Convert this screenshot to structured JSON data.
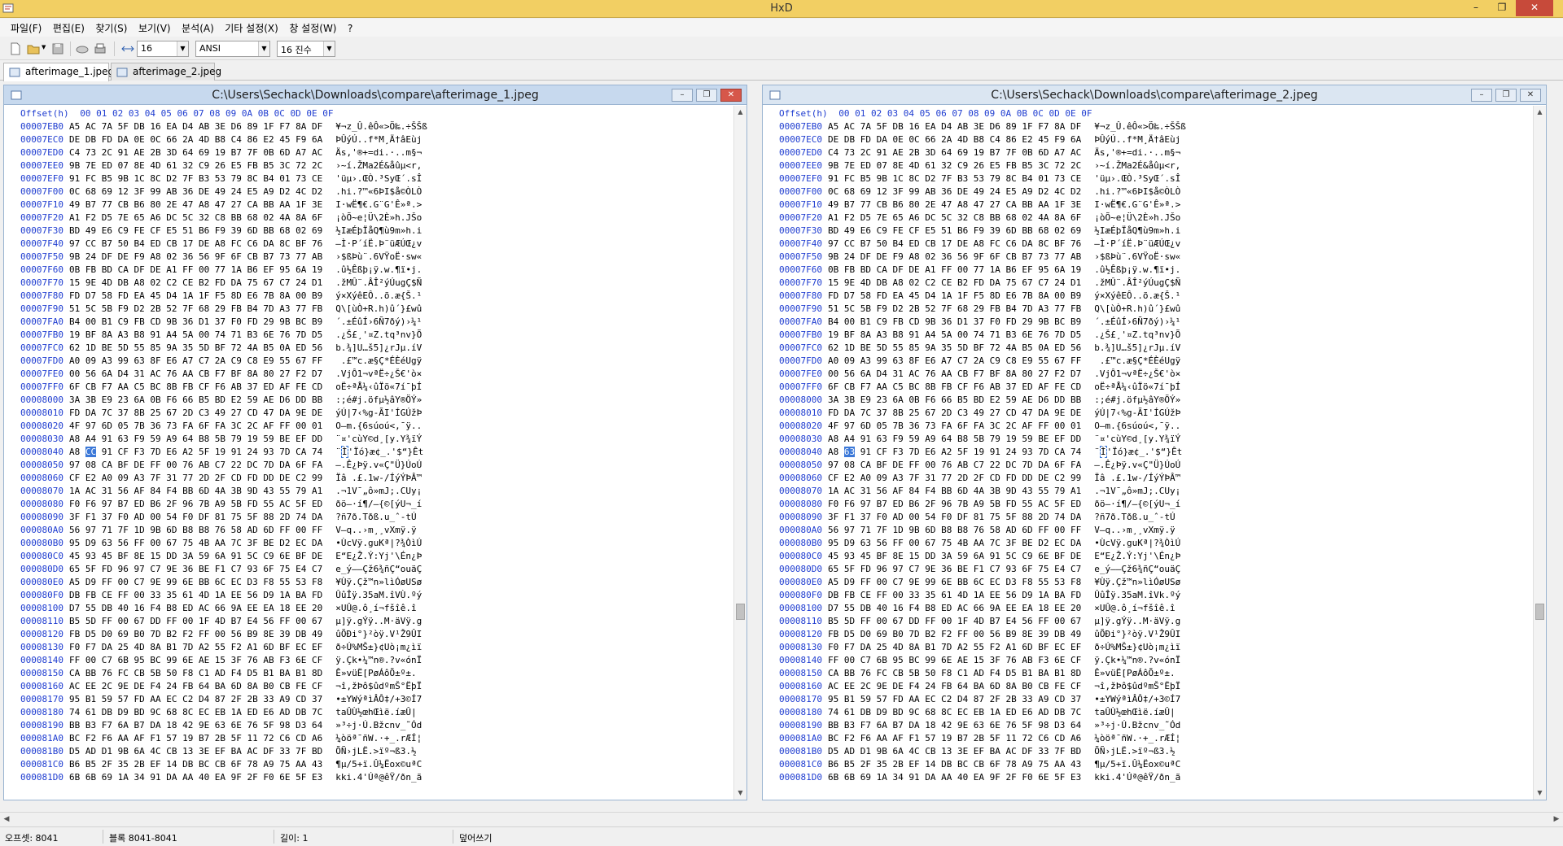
{
  "window": {
    "title": "HxD",
    "minimize_glyph": "–",
    "restore_glyph": "❐",
    "close_glyph": "✕"
  },
  "menu": [
    "파일(F)",
    "편집(E)",
    "찾기(S)",
    "보기(V)",
    "분석(A)",
    "기타 설정(X)",
    "창 설정(W)",
    "?"
  ],
  "toolbar": {
    "bytes_per_row": "16",
    "charset": "ANSI",
    "offset_base": "16 진수"
  },
  "tabs": [
    {
      "label": "afterimage_1.jpeg",
      "active": true
    },
    {
      "label": "afterimage_2.jpeg",
      "active": false
    }
  ],
  "panes": [
    {
      "path": "C:\\Users\\Sechack\\Downloads\\compare\\afterimage_1.jpeg",
      "selected_value": "CC",
      "active": true
    },
    {
      "path": "C:\\Users\\Sechack\\Downloads\\compare\\afterimage_2.jpeg",
      "selected_value": "63",
      "active": false
    }
  ],
  "hex_header": {
    "offset_label": "Offset(h)",
    "columns": "00 01 02 03 04 05 06 07 08 09 0A 0B 0C 0D 0E 0F"
  },
  "rows": [
    {
      "off": "00007EB0",
      "hex": "A5 AC 7A 5F DB 16 EA D4 AB 3E D6 89 1F F7 8A DF",
      "ascii": "¥¬z_Û.êÔ«>Ö‰.÷ŠŠß"
    },
    {
      "off": "00007EC0",
      "hex": "DE DB FD DA 0E 0C 66 2A 4D B8 C4 86 E2 45 F9 6A",
      "ascii": "ÞÛýÚ..f*M¸Ä†âEùj"
    },
    {
      "off": "00007ED0",
      "hex": "C4 73 2C 91 AE 2B 3D 64 69 19 B7 7F 0B 6D A7 AC",
      "ascii": "Äs,'®+=di.·..m§¬"
    },
    {
      "off": "00007EE0",
      "hex": "9B 7E ED 07 8E 4D 61 32 C9 26 E5 FB B5 3C 72 2C",
      "ascii": "›~í.ŽMa2É&åûµ<r,"
    },
    {
      "off": "00007EF0",
      "hex": "91 FC B5 9B 1C 8C D2 7F B3 53 79 8C B4 01 73 CE",
      "ascii": "'üµ›.ŒÒ.³SyŒ´.sÎ"
    },
    {
      "off": "00007F00",
      "hex": "0C 68 69 12 3F 99 AB 36 DE 49 24 E5 A9 D2 4C D2",
      "ascii": ".hi.?™«6ÞI$å©ÒLÒ"
    },
    {
      "off": "00007F10",
      "hex": "49 B7 77 CB B6 80 2E 47 A8 47 27 CA BB AA 1F 3E",
      "ascii": "I·wË¶€.G¨G'Ê»ª.>"
    },
    {
      "off": "00007F20",
      "hex": "A1 F2 D5 7E 65 A6 DC 5C 32 C8 BB 68 02 4A 8A 6F",
      "ascii": "¡òÕ~e¦Ü\\2È»h.JŠo"
    },
    {
      "off": "00007F30",
      "hex": "BD 49 E6 C9 FE CF E5 51 B6 F9 39 6D BB 68 02 69",
      "ascii": "½IæÉþÏåQ¶ù9m»h.i"
    },
    {
      "off": "00007F40",
      "hex": "97 CC B7 50 B4 ED CB 17 DE A8 FC C6 DA 8C BF 76",
      "ascii": "—Ì·P´íË.Þ¨üÆÚŒ¿v"
    },
    {
      "off": "00007F50",
      "hex": "9B 24 DF DE F9 A8 02 36 56 9F 6F CB B7 73 77 AB",
      "ascii": "›$ßÞù¨.6VŸoË·sw«"
    },
    {
      "off": "00007F60",
      "hex": "0B FB BD CA DF DE A1 FF 00 77 1A B6 EF 95 6A 19",
      "ascii": ".û½Êßþ¡ÿ.w.¶ï•j."
    },
    {
      "off": "00007F70",
      "hex": "15 9E 4D DB A8 02 C2 CE B2 FD DA 75 67 C7 24 D1",
      "ascii": ".žMÛ¨.ÂÎ²ýÚugÇ$Ñ"
    },
    {
      "off": "00007F80",
      "hex": "FD D7 58 FD EA 45 D4 1A 1F F5 8D E6 7B 8A 00 B9",
      "ascii": "ý×XýêEÔ..õ.æ{Š.¹"
    },
    {
      "off": "00007F90",
      "hex": "51 5C 5B F9 D2 2B 52 7F 68 29 FB B4 7D A3 77 FB",
      "ascii": "Q\\[ùÒ+R.h)û´}£wû"
    },
    {
      "off": "00007FA0",
      "hex": "B4 00 B1 C9 FB CD 9B 36 D1 37 F0 FD 29 9B BC B9",
      "ascii": "´.±ÉûÍ›6Ñ7ðý)›¼¹"
    },
    {
      "off": "00007FB0",
      "hex": "19 BF 8A A3 B8 91 A4 5A 00 74 71 B3 6E 76 7D D5",
      "ascii": ".¿Š£¸'¤Z.tq³nv}Õ"
    },
    {
      "off": "00007FC0",
      "hex": "62 1D BE 5D 55 85 9A 35 5D BF 72 4A B5 0A ED 56",
      "ascii": "b.¾]U…š5]¿rJµ.íV"
    },
    {
      "off": "00007FD0",
      "hex": "A0 09 A3 99 63 8F E6 A7 C7 2A C9 C8 E9 55 67 FF",
      "ascii": " .£™c.æ§Ç*ÉÈéUgÿ"
    },
    {
      "off": "00007FE0",
      "hex": "00 56 6A D4 31 AC 76 AA CB F7 BF 8A 80 27 F2 D7",
      "ascii": ".VjÔ1¬vªË÷¿Š€'ò×"
    },
    {
      "off": "00007FF0",
      "hex": "6F CB F7 AA C5 BC 8B FB CF F6 AB 37 ED AF FE CD",
      "ascii": "oË÷ªÅ¼‹ûÏö«7í¯þÍ"
    },
    {
      "off": "00008000",
      "hex": "3A 3B E9 23 6A 0B F6 66 B5 BD E2 59 AE D6 DD BB",
      "ascii": ":;é#j.öfµ½âY®ÖÝ»"
    },
    {
      "off": "00008010",
      "hex": "FD DA 7C 37 8B 25 67 2D C3 49 27 CD 47 DA 9E DE",
      "ascii": "ýÚ|7‹%g-ÃI'ÍGÚžÞ"
    },
    {
      "off": "00008020",
      "hex": "4F 97 6D 05 7B 36 73 FA 6F FA 3C 2C AF FF 00 01",
      "ascii": "O—m.{6súoú<,¯ÿ.."
    },
    {
      "off": "00008030",
      "hex": "A8 A4 91 63 F9 59 A9 64 B8 5B 79 19 59 BE EF DD",
      "ascii": "¨¤'cùY©d¸[y.Y¾ïÝ"
    },
    {
      "off": "00008040",
      "hex_pre": "A8 ",
      "hex_mid": "",
      "hex_post": " 91 CF F3 7D E6 A2 5F 19 91 24 93 7D CA 74",
      "ascii_pre": "¨",
      "ascii_mid": "Ì",
      "ascii_post": "'Ïó}æ¢_.'$“}Êt",
      "selected": true
    },
    {
      "off": "00008050",
      "hex": "97 08 CA BF DE FF 00 76 AB C7 22 DC 7D DA 6F FA",
      "ascii": "—.Ê¿Þÿ.v«Ç\"Ü}ÚoÚ"
    },
    {
      "off": "00008060",
      "hex": "CF E2 A0 09 A3 7F 31 77 2D 2F CD FD DD DE C2 99",
      "ascii": "Ïâ .£.1w-/ÍýÝÞÂ™"
    },
    {
      "off": "00008070",
      "hex": "1A AC 31 56 AF 84 F4 BB 6D 4A 3B 9D 43 55 79 A1",
      "ascii": ".¬1V¯„ô»mJ;.CUy¡"
    },
    {
      "off": "00008080",
      "hex": "F0 F6 97 B7 ED B6 2F 96 7B A9 5B FD 55 AC 5F ED",
      "ascii": "ðö—·í¶/–{©[ýU¬_í"
    },
    {
      "off": "00008090",
      "hex": "3F F1 37 F0 AD 00 54 F0 DF 81 75 5F 88 2D 74 DA",
      "ascii": "?ñ7ð­.Tðß.u_ˆ-tÚ"
    },
    {
      "off": "000080A0",
      "hex": "56 97 71 7F 1D 9B 6D B8 B8 76 58 AD 6D FF 00 FF",
      "ascii": "V—q..›m¸¸vX­mÿ.ÿ"
    },
    {
      "off": "000080B0",
      "hex": "95 D9 63 56 FF 00 67 75 4B AA 7C 3F BE D2 EC DA",
      "ascii": "•ÙcVÿ.guKª|?¾ÒìÚ"
    },
    {
      "off": "000080C0",
      "hex": "45 93 45 BF 8E 15 DD 3A 59 6A 91 5C C9 6E BF DE",
      "ascii": "E“E¿Ž.Ý:Yj'\\Én¿Þ"
    },
    {
      "off": "000080D0",
      "hex": "65 5F FD 96 97 C7 9E 36 BE F1 C7 93 6F 75 E4 C7",
      "ascii": "e_ý–—Çž6¾ñÇ“ouäÇ"
    },
    {
      "off": "000080E0",
      "hex": "A5 D9 FF 00 C7 9E 99 6E BB 6C EC D3 F8 55 53 F8",
      "ascii": "¥Ùÿ.Çž™n»lìÓøUSø"
    },
    {
      "off": "000080F0",
      "hex": "DB FB CE FF 00 33 35 61 4D 1A EE 56 D9 1A BA FD",
      "ascii": "ÛûÎÿ.35aM.îVÙ.ºý"
    },
    {
      "off": "00008100",
      "hex": "D7 55 DB 40 16 F4 B8 ED AC 66 9A EE EA 18 EE 20",
      "ascii": "×UÛ@.ô¸í¬fšîê.î "
    },
    {
      "off": "00008110",
      "hex": "B5 5D FF 00 67 DD FF 00 1F 4D B7 E4 56 FF 00 67",
      "ascii": "µ]ÿ.gÝÿ..M·äVÿ.g"
    },
    {
      "off": "00008120",
      "hex": "FB D5 D0 69 B0 7D B2 F2 FF 00 56 B9 8E 39 DB 49",
      "ascii": "ûÕÐi°}²òÿ.V¹Ž9ÛI"
    },
    {
      "off": "00008130",
      "hex": "F0 F7 DA 25 4D 8A B1 7D A2 55 F2 A1 6D BF EC EF",
      "ascii": "ð÷Ú%MŠ±}¢Uò¡m¿ìï"
    },
    {
      "off": "00008140",
      "hex": "FF 00 C7 6B 95 BC 99 6E AE 15 3F 76 AB F3 6E CF",
      "ascii": "ÿ.Çk•¼™n®.?v«ónÏ"
    },
    {
      "off": "00008150",
      "hex": "CA BB 76 FC CB 5B 50 F8 C1 AD F4 D5 B1 BA B1 8D",
      "ascii": "Ê»vüË[PøÁ­ôÕ±º±."
    },
    {
      "off": "00008160",
      "hex": "AC EE 2C 9E DE F4 24 FB 64 BA 6D 8A B0 CB FE CF",
      "ascii": "¬î,žÞô$ûdºmŠ°ËþÏ"
    },
    {
      "off": "00008170",
      "hex": "95 B1 59 57 FD AA EC C2 D4 87 2F 2B 33 A9 CD 37",
      "ascii": "•±YWýªìÂÔ‡/+3©Í7"
    },
    {
      "off": "00008180",
      "hex": "74 61 DB D9 BD 9C 68 8C EC EB 1A ED E6 AD DB 7C",
      "ascii": "taÛÙ½œhŒìë.íæ­Û|"
    },
    {
      "off": "00008190",
      "hex": "BB B3 F7 6A B7 DA 18 42 9E 63 6E 76 5F 98 D3 64",
      "ascii": "»³÷j·Ú.Bžcnv_˜Ód"
    },
    {
      "off": "000081A0",
      "hex": "BC F2 F6 AA AF F1 57 19 B7 2B 5F 11 72 C6 CD A6",
      "ascii": "¼òöª¯ñW.·+_.rÆÍ¦"
    },
    {
      "off": "000081B0",
      "hex": "D5 AD D1 9B 6A 4C CB 13 3E EF BA AC DF 33 7F BD",
      "ascii": "Õ­Ñ›jLË.>ïº¬ß3.½"
    },
    {
      "off": "000081C0",
      "hex": "B6 B5 2F 35 2B EF 14 DB BC CB 6F 78 A9 75 AA 43",
      "ascii": "¶µ/5+ï.Û¼Ëox©uªC"
    },
    {
      "off": "000081D0",
      "hex": "6B 6B 69 1A 34 91 DA AA 40 EA 9F 2F F0 6E 5F E3",
      "ascii": "kki.4'Úª@êŸ/ðn_ã"
    }
  ],
  "rows_right_diff": {
    "00007EF0": "'üµ›.ŒÒ.³SyŒ´.sÎ",
    "000080F0": "ÛûÎÿ.35aM.îVk.ºý"
  },
  "status": {
    "offset": "오프셋: 8041",
    "block": "블록 8041-8041",
    "length": "길이: 1",
    "mode": "덮어쓰기"
  }
}
